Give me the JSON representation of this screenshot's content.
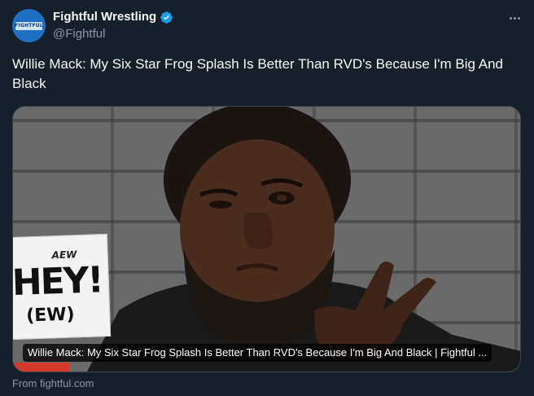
{
  "account": {
    "display_name": "Fightful Wrestling",
    "handle": "@Fightful",
    "avatar_text": "FIGHTFUL",
    "verified": true
  },
  "tweet": {
    "text": "Willie Mack: My Six Star Frog Splash Is Better Than RVD's Because I'm Big And Black"
  },
  "card": {
    "caption": "Willie Mack: My Six Star Frog Splash Is Better Than RVD's Because I'm Big And Black | Fightful ...",
    "sign_brand": "AEW",
    "sign_main": "HEY!",
    "sign_sub": "(EW)",
    "source": "From fightful.com"
  },
  "colors": {
    "background": "#15202b",
    "verified": "#1d9bf0",
    "secondary_text": "#8b98a5"
  },
  "icons": {
    "verified": "verified-badge-icon",
    "more": "more-options-icon"
  }
}
